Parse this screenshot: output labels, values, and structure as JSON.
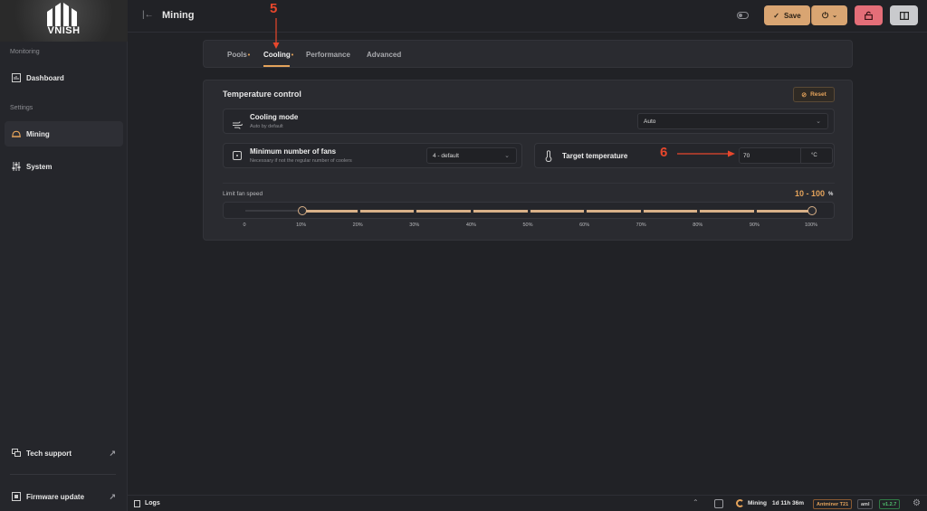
{
  "app": {
    "logo_text": "VNISH",
    "page_title": "Mining"
  },
  "sidebar": {
    "section_monitoring": "Monitoring",
    "section_settings": "Settings",
    "dashboard": "Dashboard",
    "mining": "Mining",
    "system": "System",
    "tech_support": "Tech support",
    "firmware_update": "Firmware update"
  },
  "toolbar": {
    "save_label": "Save"
  },
  "tabs": [
    {
      "label": "Pools",
      "modified": "•"
    },
    {
      "label": "Cooling",
      "modified": "•"
    },
    {
      "label": "Performance"
    },
    {
      "label": "Advanced"
    }
  ],
  "temperature_control": {
    "title": "Temperature control",
    "reset_label": "Reset",
    "cooling_mode": {
      "label": "Cooling mode",
      "hint": "Auto by default",
      "value": "Auto"
    },
    "min_fans": {
      "label": "Minimum number of fans",
      "hint": "Necessary if not the regular number of coolers",
      "value": "4 - default"
    },
    "target_temp": {
      "label": "Target temperature",
      "value": "70",
      "unit": "°C"
    },
    "fan_speed": {
      "label": "Limit fan speed",
      "range_value": "10 - 100",
      "range_unit": "%",
      "min": 10,
      "max": 100,
      "ticks": [
        "0",
        "10%",
        "20%",
        "30%",
        "40%",
        "50%",
        "60%",
        "70%",
        "80%",
        "90%",
        "100%"
      ]
    }
  },
  "statusbar": {
    "logs": "Logs",
    "state": "Mining",
    "uptime": "1d 11h 36m",
    "model": "Antminer T21",
    "fw_type": "aml",
    "version": "v1.2.7"
  },
  "annotations": {
    "step5": "5",
    "step6": "6"
  },
  "colors": {
    "accent": "#e4a35b",
    "save_bg": "#d9a572",
    "lock_bg": "#e46e78",
    "version_green": "#4fbf6e"
  }
}
